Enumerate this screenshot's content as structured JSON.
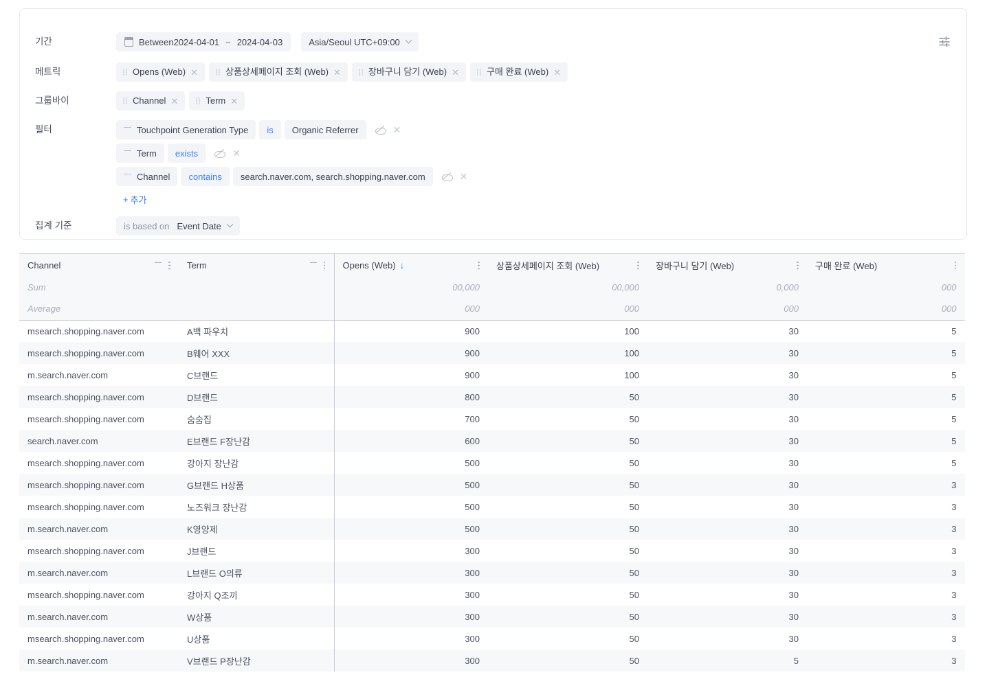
{
  "query": {
    "rows": [
      {
        "label": "기간"
      },
      {
        "label": "메트릭"
      },
      {
        "label": "그룹바이"
      },
      {
        "label": "필터"
      },
      {
        "label": "집계 기준"
      }
    ],
    "period": {
      "mode_label": "Between",
      "start_date": "2024-04-01",
      "separator": "~",
      "end_date": "2024-04-03",
      "timezone": "Asia/Seoul UTC+09:00",
      "calendar_icon": "calendar-icon",
      "caret_icon": "chevron-down-icon"
    },
    "metrics": [
      {
        "label": "Opens (Web)"
      },
      {
        "label": "상품상세페이지 조회 (Web)"
      },
      {
        "label": "장바구니 담기 (Web)"
      },
      {
        "label": "구매 완료 (Web)"
      }
    ],
    "groupby": [
      {
        "label": "Channel"
      },
      {
        "label": "Term"
      }
    ],
    "filters": [
      {
        "field": "Touchpoint Generation Type",
        "operator": "is",
        "value": "Organic Referrer",
        "has_value": true
      },
      {
        "field": "Term",
        "operator": "exists",
        "value": "",
        "has_value": false
      },
      {
        "field": "Channel",
        "operator": "contains",
        "value": "search.naver.com, search.shopping.naver.com",
        "has_value": true
      }
    ],
    "add_filter_label": "추가",
    "add_filter_plus": "+",
    "aggregation": {
      "lead_label": "is based on",
      "value": "Event Date"
    },
    "settings_icon": "sliders-icon"
  },
  "table": {
    "columns": [
      {
        "key": "channel",
        "label": "Channel",
        "type": "text",
        "has_filter": true,
        "has_menu": true,
        "sorted": false
      },
      {
        "key": "term",
        "label": "Term",
        "type": "text",
        "has_filter": true,
        "has_menu": true,
        "sorted": false
      },
      {
        "key": "opens",
        "label": "Opens (Web)",
        "type": "num",
        "has_filter": false,
        "has_menu": true,
        "sorted": true,
        "sort_arrow": "↓"
      },
      {
        "key": "pdp",
        "label": "상품상세페이지 조회 (Web)",
        "type": "num",
        "has_filter": false,
        "has_menu": true,
        "sorted": false
      },
      {
        "key": "cart",
        "label": "장바구니 담기 (Web)",
        "type": "num",
        "has_filter": false,
        "has_menu": true,
        "sorted": false
      },
      {
        "key": "purchase",
        "label": "구매 완료 (Web)",
        "type": "num",
        "has_filter": false,
        "has_menu": true,
        "sorted": false
      }
    ],
    "aggregates": [
      {
        "label": "Sum",
        "values": [
          "00,000",
          "00,000",
          "0,000",
          "000"
        ]
      },
      {
        "label": "Average",
        "values": [
          "000",
          "000",
          "000",
          "000"
        ]
      }
    ],
    "rows": [
      {
        "channel": "msearch.shopping.naver.com",
        "term": "A백 파우치",
        "opens": "900",
        "pdp": "100",
        "cart": "30",
        "purchase": "5"
      },
      {
        "channel": "msearch.shopping.naver.com",
        "term": "B웨어 XXX",
        "opens": "900",
        "pdp": "100",
        "cart": "30",
        "purchase": "5"
      },
      {
        "channel": "m.search.naver.com",
        "term": "C브랜드",
        "opens": "900",
        "pdp": "100",
        "cart": "30",
        "purchase": "5"
      },
      {
        "channel": "msearch.shopping.naver.com",
        "term": "D브랜드",
        "opens": "800",
        "pdp": "50",
        "cart": "30",
        "purchase": "5"
      },
      {
        "channel": "msearch.shopping.naver.com",
        "term": "숨숨집",
        "opens": "700",
        "pdp": "50",
        "cart": "30",
        "purchase": "5"
      },
      {
        "channel": "search.naver.com",
        "term": "E브랜드 F장난감",
        "opens": "600",
        "pdp": "50",
        "cart": "30",
        "purchase": "5"
      },
      {
        "channel": "msearch.shopping.naver.com",
        "term": "강아지 장난감",
        "opens": "500",
        "pdp": "50",
        "cart": "30",
        "purchase": "5"
      },
      {
        "channel": "msearch.shopping.naver.com",
        "term": "G브랜드 H상품",
        "opens": "500",
        "pdp": "50",
        "cart": "30",
        "purchase": "3"
      },
      {
        "channel": "msearch.shopping.naver.com",
        "term": "노즈워크 장난감",
        "opens": "500",
        "pdp": "50",
        "cart": "30",
        "purchase": "3"
      },
      {
        "channel": "m.search.naver.com",
        "term": "K영양제",
        "opens": "500",
        "pdp": "50",
        "cart": "30",
        "purchase": "3"
      },
      {
        "channel": "msearch.shopping.naver.com",
        "term": "J브랜드",
        "opens": "300",
        "pdp": "50",
        "cart": "30",
        "purchase": "3"
      },
      {
        "channel": "m.search.naver.com",
        "term": "L브랜드 O의류",
        "opens": "300",
        "pdp": "50",
        "cart": "30",
        "purchase": "3"
      },
      {
        "channel": "msearch.shopping.naver.com",
        "term": "강아지 Q조끼",
        "opens": "300",
        "pdp": "50",
        "cart": "30",
        "purchase": "3"
      },
      {
        "channel": "m.search.naver.com",
        "term": "W상품",
        "opens": "300",
        "pdp": "50",
        "cart": "30",
        "purchase": "3"
      },
      {
        "channel": "msearch.shopping.naver.com",
        "term": "U상품",
        "opens": "300",
        "pdp": "50",
        "cart": "30",
        "purchase": "3"
      },
      {
        "channel": "m.search.naver.com",
        "term": "V브랜드 P장난감",
        "opens": "300",
        "pdp": "50",
        "cart": "5",
        "purchase": "3"
      }
    ]
  },
  "colors": {
    "accent": "#3b82f6",
    "chip_bg": "#f2f4f8",
    "header_bg": "#f7f8fa",
    "row_alt_bg": "#f7f8fa",
    "border": "#e6e9ef",
    "text": "#3c4250",
    "muted": "#a8aeba"
  }
}
